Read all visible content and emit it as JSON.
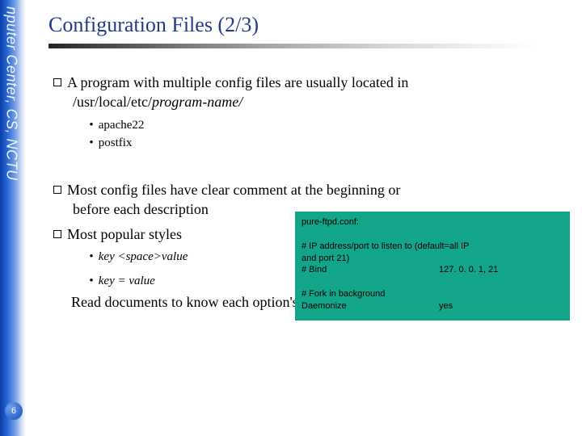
{
  "sidebar": {
    "text": "nputer Center, CS, NCTU"
  },
  "page_number": "6",
  "title": "Configuration Files (2/3)",
  "bullets": {
    "b1_line1": "A program with multiple config files are usually located in",
    "b1_path_plain": "/usr/local/etc/",
    "b1_path_italic": "program-name/",
    "b1_sub1": "apache22",
    "b1_sub2": "postfix",
    "b2_line1": "Most config files have clear comment at the beginning or",
    "b2_line2": "before each description",
    "b3": "Most popular styles",
    "b3_sub1": "key <space>value",
    "b3_sub2": "key = value",
    "read_line": "Read documents to know each option's meaning"
  },
  "codebox": {
    "filename": "pure-ftpd.conf:",
    "blank": " ",
    "ip_comment1": "# IP address/port to listen to (default=all IP",
    "ip_comment2": "and port 21)",
    "bind_key": "# Bind",
    "bind_val": "127. 0. 0. 1, 21",
    "fork_comment": "# Fork in background",
    "daemonize_key": "Daemonize",
    "daemonize_val": "yes"
  }
}
